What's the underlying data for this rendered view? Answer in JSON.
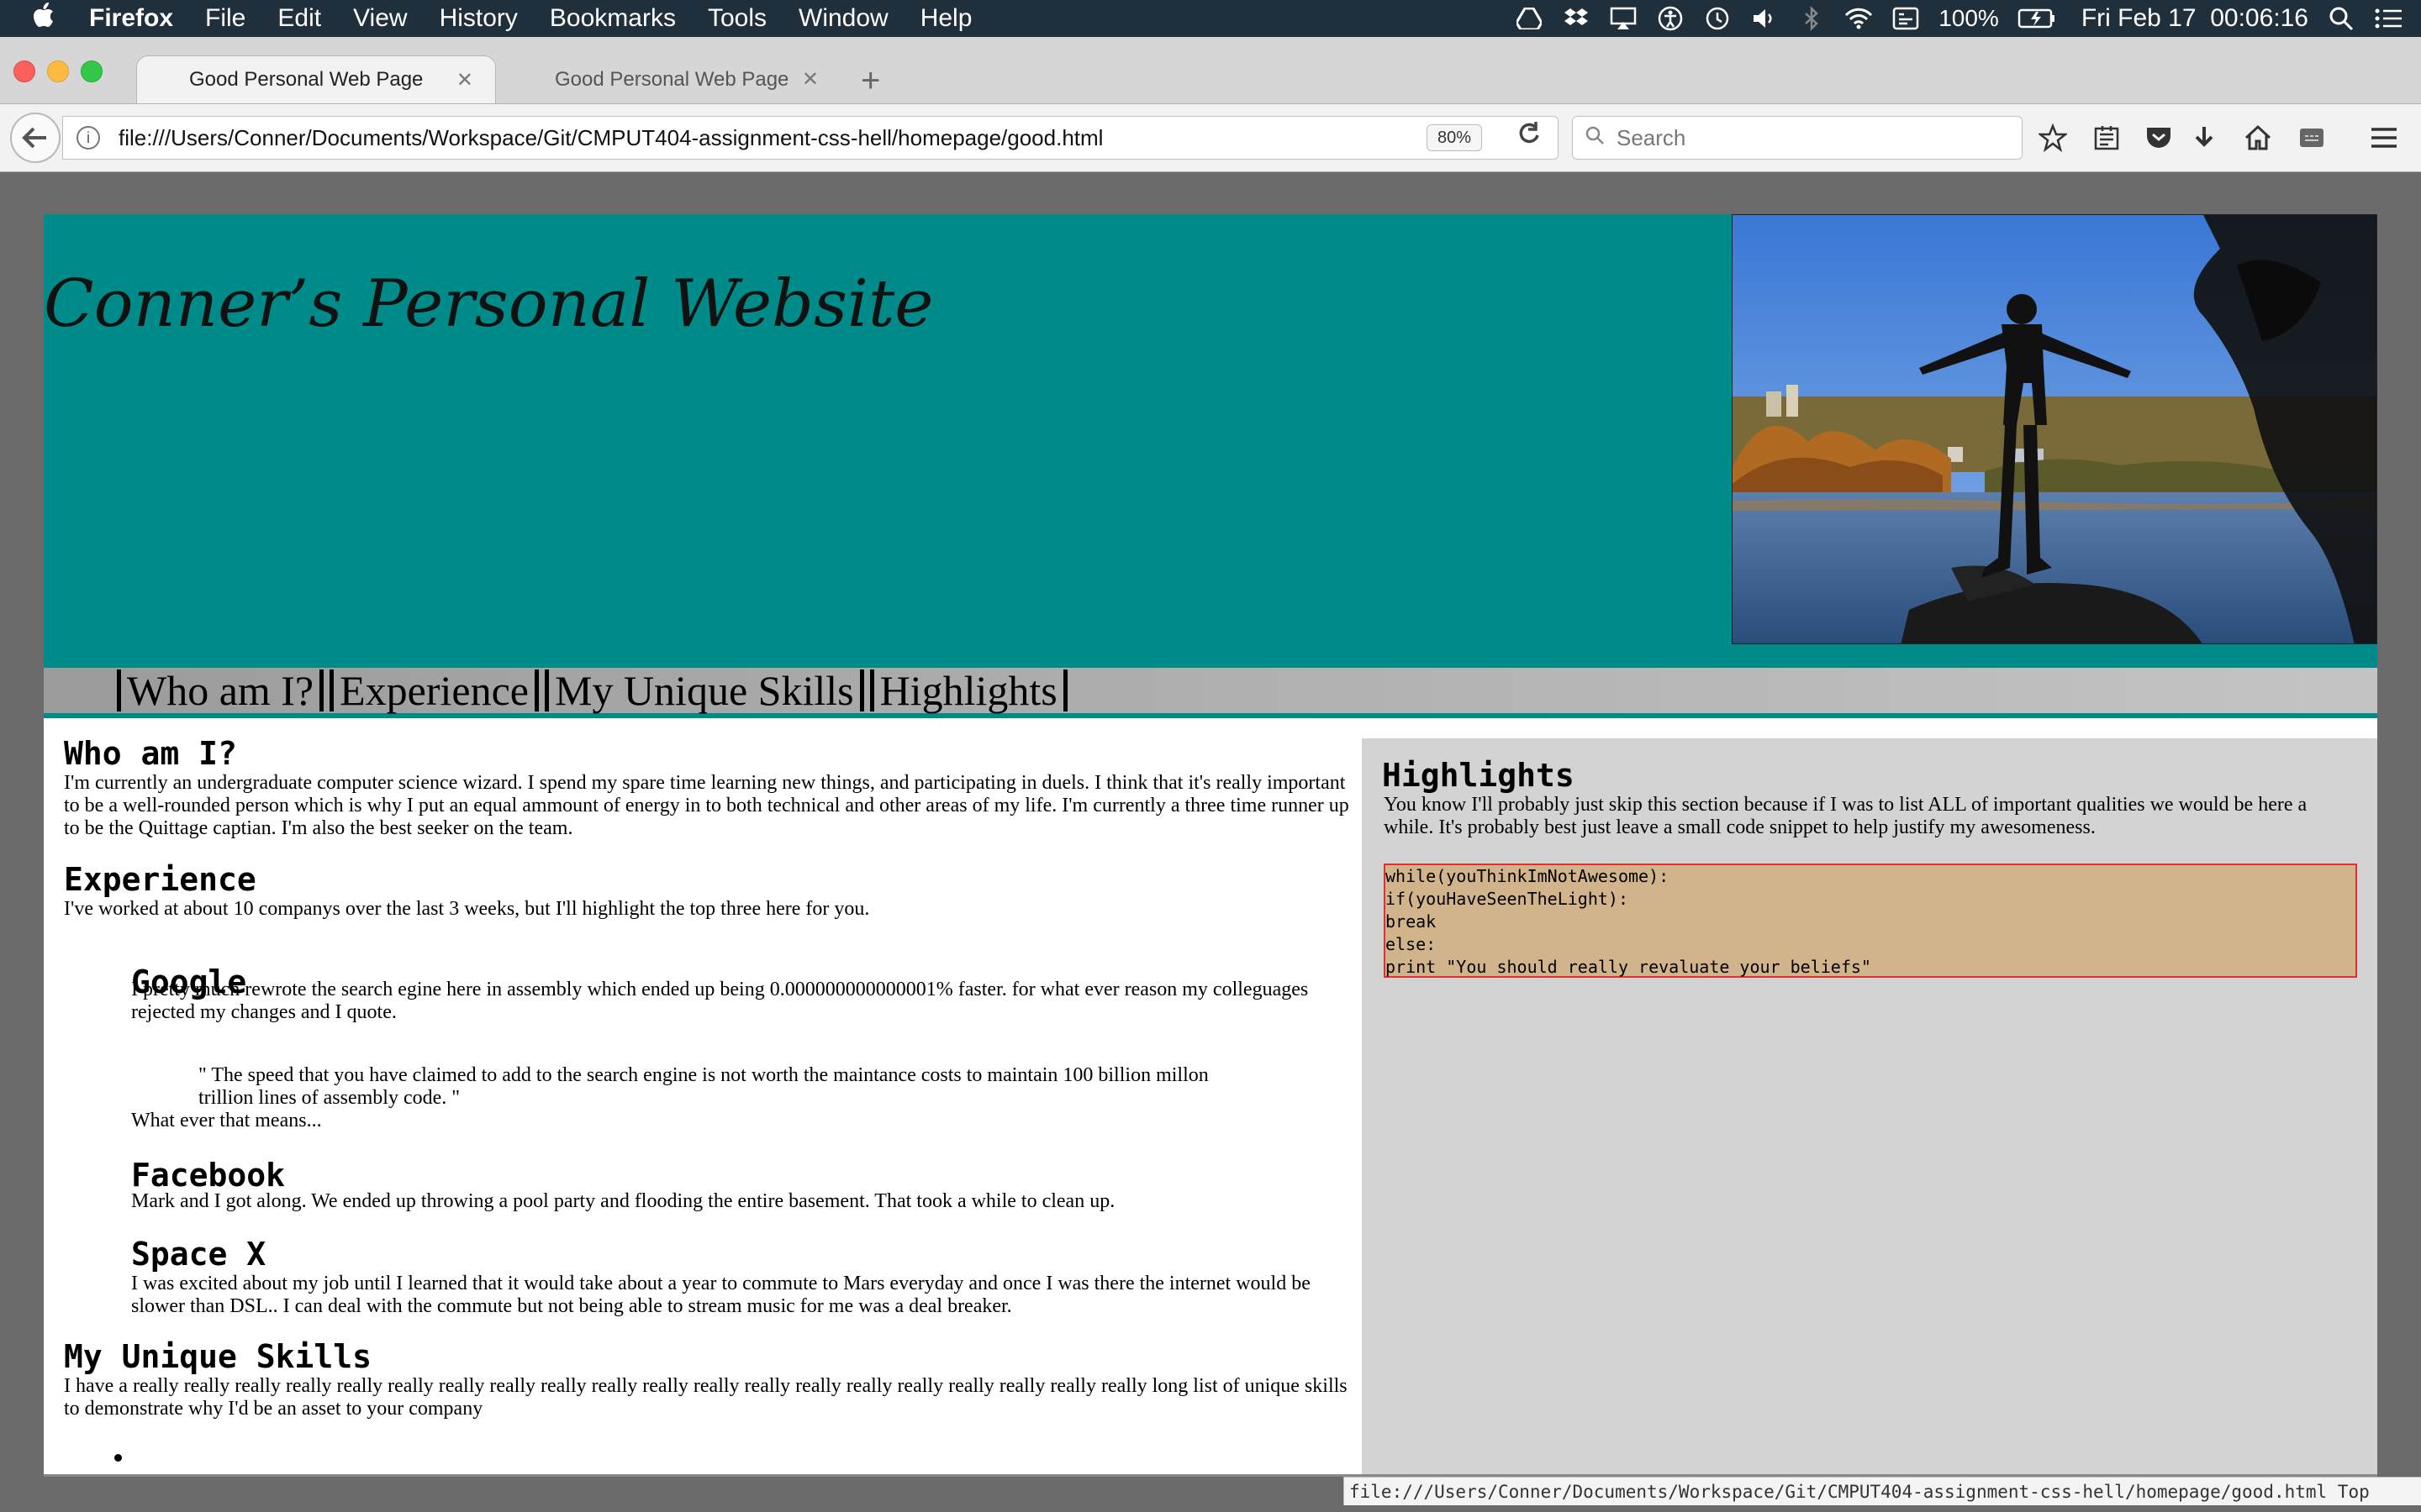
{
  "menubar": {
    "app": "Firefox",
    "items": [
      "File",
      "Edit",
      "View",
      "History",
      "Bookmarks",
      "Tools",
      "Window",
      "Help"
    ],
    "battery": "100%",
    "clock": "Fri Feb 17  00:06:16"
  },
  "tabs": [
    {
      "title": "Good Personal Web Page",
      "active": true
    },
    {
      "title": "Good Personal Web Page",
      "active": false
    }
  ],
  "toolbar": {
    "url": "file:///Users/Conner/Documents/Workspace/Git/CMPUT404-assignment-css-hell/homepage/good.html",
    "zoom": "80%",
    "search_placeholder": "Search"
  },
  "page": {
    "title": "Conner’s Personal Website",
    "nav": [
      "Who am I?",
      "Experience",
      "My Unique Skills",
      "Highlights"
    ],
    "who": {
      "heading": "Who am I?",
      "text": "I'm currently an undergraduate computer science wizard. I spend my spare time learning new things, and participating in duels. I think that it's really important to be a well-rounded person which is why I put an equal ammount of energy in to both technical and other areas of my life. I'm currently a three time runner up to be the Quittage captian. I'm also the best seeker on the team."
    },
    "experience": {
      "heading": "Experience",
      "intro": "I've worked at about 10 companys over the last 3 weeks, but I'll highlight the top three here for you.",
      "jobs": [
        {
          "name": "Google",
          "text": "I pretty much rewrote the search egine here in assembly which ended up being 0.000000000000001% faster. for what ever reason my colleguages rejected my changes and I quote.",
          "quote": "\" The speed that you have claimed to add to the search engine is not worth the maintance costs to maintain 100 billion millon trillion lines of assembly code. \"",
          "after": "What ever that means..."
        },
        {
          "name": "Facebook",
          "text": "Mark and I got along. We ended up throwing a pool party and flooding the entire basement. That took a while to clean up."
        },
        {
          "name": "Space X",
          "text": "I was excited about my job until I learned that it would take about a year to commute to Mars everyday and once I was there the internet would be slower than DSL.. I can deal with the commute but not being able to stream music for me was a deal breaker."
        }
      ]
    },
    "skills": {
      "heading": "My Unique Skills",
      "text": "I have a really really really really really really really really really really really really really really really really really really really really long list of unique skills to demonstrate why I'd be an asset to your company"
    },
    "highlights": {
      "heading": "Highlights",
      "text": "You know I'll probably just skip this section because if I was to list ALL of important qualities we would be here a while. It's probably best just leave a small code snippet to help justify my awesomeness.",
      "code": [
        "while(youThinkImNotAwesome):",
        "if(youHaveSeenTheLight):",
        "break",
        "else:",
        "print \"You should really revaluate your beliefs\""
      ]
    }
  },
  "statusbar": {
    "text": "file:///Users/Conner/Documents/Workspace/Git/CMPUT404-assignment-css-hell/homepage/good.html Top"
  },
  "colors": {
    "header": "#008b8b",
    "code_bg": "#d2b48c",
    "code_border": "#e03030",
    "sidebar_bg": "#d3d3d3"
  }
}
